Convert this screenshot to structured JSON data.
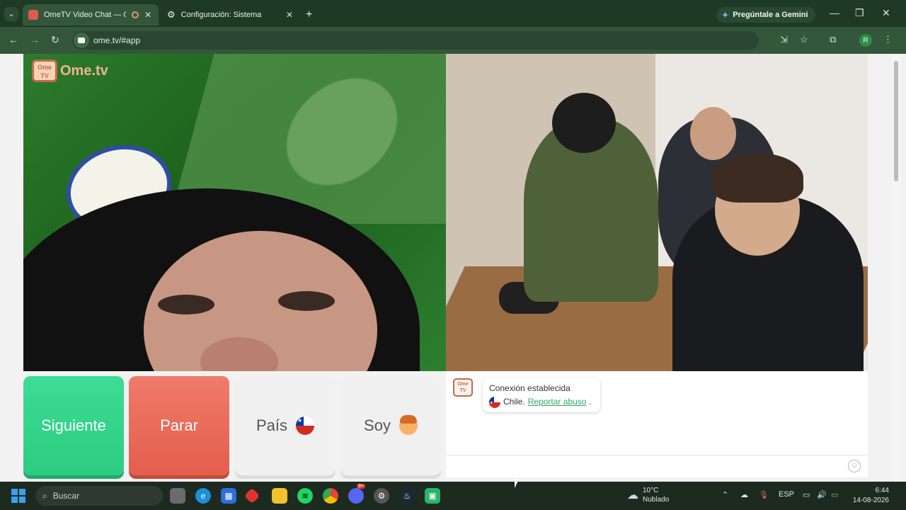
{
  "browser": {
    "tabs": [
      {
        "label": "OmeTV Video Chat — Ome",
        "active": true
      },
      {
        "label": "Configuración: Sistema",
        "active": false
      }
    ],
    "gemini_label": "Pregúntale a Gemini",
    "url": "ome.tv/#app",
    "profile_initial": "R"
  },
  "logo": {
    "box_text": "Ome TV",
    "text": "Ome.tv"
  },
  "controls": {
    "next_label": "Siguiente",
    "stop_label": "Parar",
    "country_label": "País",
    "gender_label": "Soy"
  },
  "chat": {
    "logo_text": "Ome TV",
    "status_message": "Conexión establecida",
    "country": "Chile.",
    "report_link": "Reportar abuso",
    "report_suffix": "."
  },
  "taskbar": {
    "search_placeholder": "Buscar",
    "weather_temp": "10°C",
    "weather_desc": "Nublado",
    "language": "ESP",
    "time": "6:44",
    "date": "14-08-2026",
    "discord_badge": "9+"
  },
  "colors": {
    "next": "#2ccc82",
    "stop": "#e45e4c",
    "link": "#2fa66b",
    "browser_frame": "#34573c"
  }
}
